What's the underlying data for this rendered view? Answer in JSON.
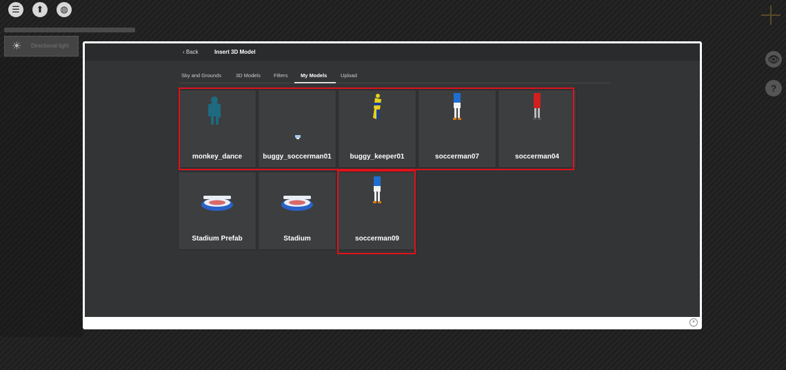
{
  "app": {
    "top_icons": [
      "menu-icon",
      "upload-icon",
      "globe-icon"
    ],
    "light_item_label": "Directional light",
    "right_icons": [
      "eye-icon",
      "help-icon"
    ],
    "help_glyph": "?",
    "eye_glyph": "👁"
  },
  "modal": {
    "back_label": "Back",
    "title": "Insert 3D Model",
    "tabs": [
      {
        "label": "Sky and Grounds",
        "active": false
      },
      {
        "label": "3D Models",
        "active": false
      },
      {
        "label": "Filters",
        "active": false
      },
      {
        "label": "My Models",
        "active": true
      },
      {
        "label": "Upload",
        "active": false
      }
    ],
    "models": [
      {
        "name": "monkey_dance",
        "thumb": "monkey-figure",
        "color": "#1e6a80"
      },
      {
        "name": "buggy_soccerman01",
        "thumb": "small-figure",
        "color": "#3b7fc4"
      },
      {
        "name": "buggy_keeper01",
        "thumb": "keeper-figure",
        "color": "#e6d21a"
      },
      {
        "name": "soccerman07",
        "thumb": "player-figure",
        "color": "#1e6fd0"
      },
      {
        "name": "soccerman04",
        "thumb": "player-figure",
        "color": "#d01f1f"
      },
      {
        "name": "Stadium Prefab",
        "thumb": "stadium",
        "color": "#2a62c9"
      },
      {
        "name": "Stadium",
        "thumb": "stadium",
        "color": "#2a62c9"
      },
      {
        "name": "soccerman09",
        "thumb": "player-figure",
        "color": "#1e6fd0"
      }
    ],
    "close_glyph": "×"
  }
}
